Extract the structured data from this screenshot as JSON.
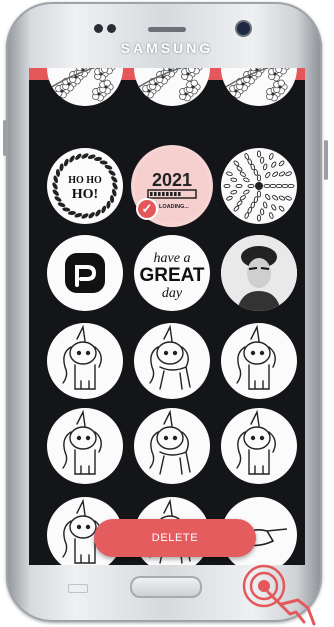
{
  "device": {
    "brand": "SAMSUNG"
  },
  "screen": {
    "header_color": "#e4585b",
    "background": "#141518",
    "stickers": [
      {
        "name": "sticker-cherry-blossom-left",
        "design": "cherry-blossom",
        "selected": false
      },
      {
        "name": "sticker-cherry-blossom-center",
        "design": "cherry-blossom",
        "selected": false
      },
      {
        "name": "sticker-cherry-blossom-right",
        "design": "cherry-blossom",
        "selected": false
      },
      {
        "name": "sticker-ho-ho-ho-wreath",
        "design": "wreath",
        "lines": [
          "HO HO",
          "HO!"
        ],
        "selected": false
      },
      {
        "name": "sticker-2021-loading",
        "design": "loading",
        "year": "2021",
        "caption": "LOADING...",
        "progress": 0.7,
        "selected": true
      },
      {
        "name": "sticker-mandala",
        "design": "mandala",
        "selected": false
      },
      {
        "name": "sticker-p-logo",
        "design": "p-logo",
        "selected": false
      },
      {
        "name": "sticker-have-a-great-day",
        "design": "lettering",
        "lines": [
          "have a",
          "GREAT",
          "day"
        ],
        "selected": false
      },
      {
        "name": "sticker-frida-portrait",
        "design": "portrait",
        "selected": false
      },
      {
        "name": "sticker-unicorn-sitting",
        "design": "unicorn",
        "selected": false
      },
      {
        "name": "sticker-unicorn-galloping",
        "design": "unicorn",
        "selected": false
      },
      {
        "name": "sticker-unicorn-standing",
        "design": "unicorn",
        "selected": false
      },
      {
        "name": "sticker-unicorn-head",
        "design": "unicorn",
        "selected": false
      },
      {
        "name": "sticker-unicorn-mane",
        "design": "unicorn",
        "selected": false
      },
      {
        "name": "sticker-unicorn-jumping",
        "design": "unicorn",
        "selected": false
      },
      {
        "name": "sticker-unicorn-partial-left",
        "design": "unicorn",
        "selected": false
      },
      {
        "name": "sticker-unicorn-partial-center",
        "design": "unicorn",
        "selected": false
      },
      {
        "name": "sticker-hand-partial-right",
        "design": "hand",
        "selected": false
      }
    ],
    "delete_label": "DELETE",
    "accent": "#e45c5e"
  }
}
